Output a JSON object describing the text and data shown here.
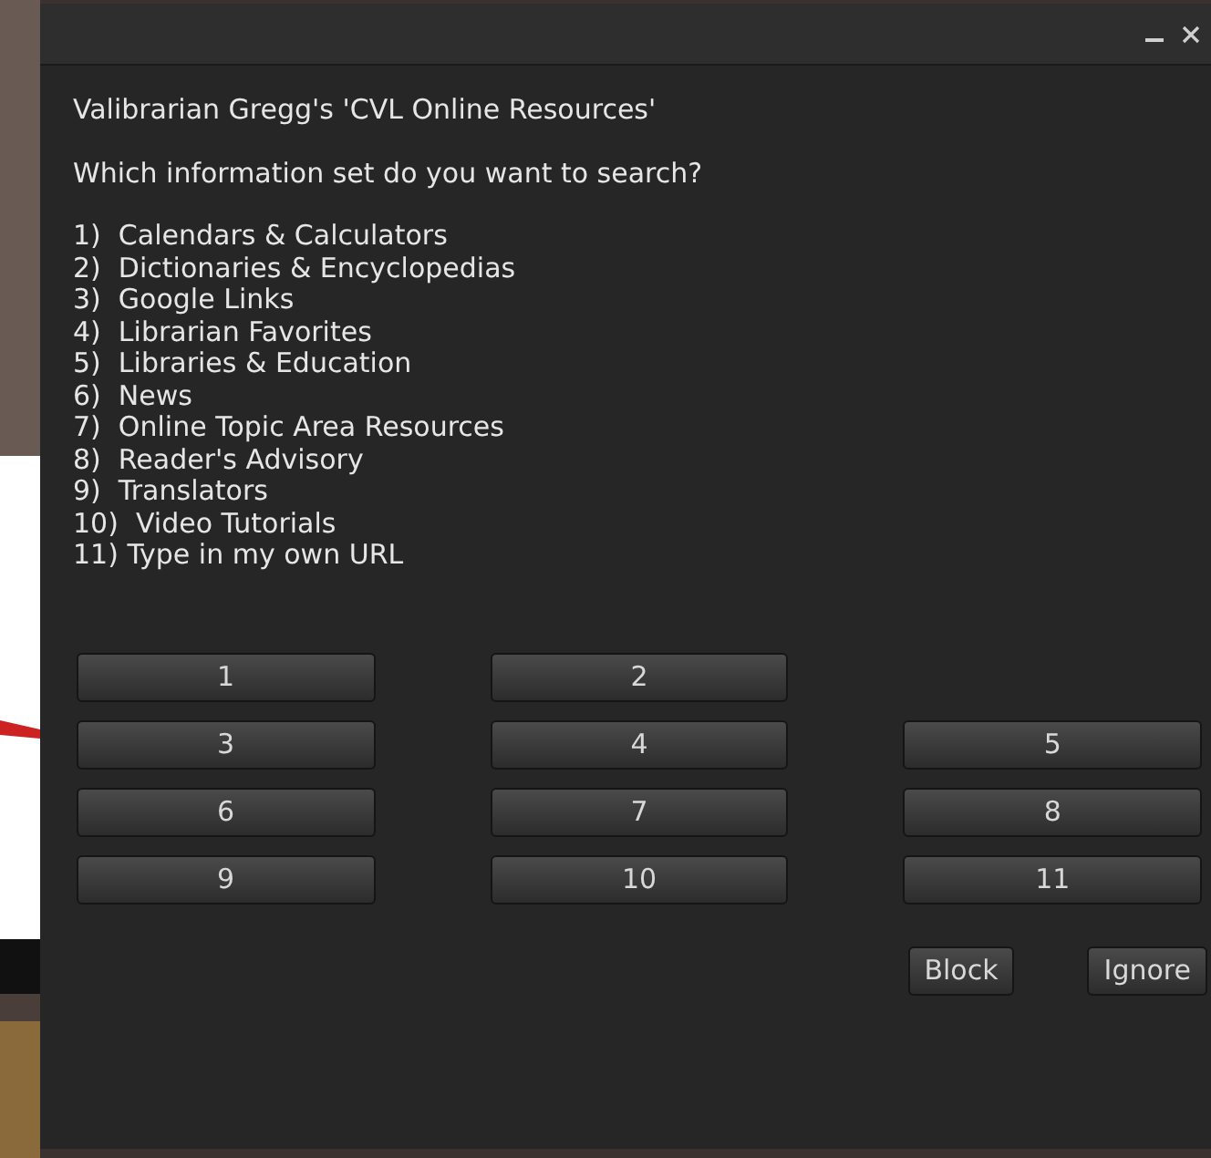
{
  "dialog": {
    "heading": "Valibrarian Gregg's 'CVL Online Resources'",
    "question": "Which information set do you want to search?",
    "options": [
      "1)  Calendars & Calculators",
      "2)  Dictionaries & Encyclopedias",
      "3)  Google Links",
      "4)  Librarian Favorites",
      "5)  Libraries & Education",
      "6)  News",
      "7)  Online Topic Area Resources",
      "8)  Reader's Advisory",
      "9)  Translators",
      "10)  Video Tutorials",
      "11) Type in my own URL"
    ],
    "choice_buttons": [
      "1",
      "2",
      "3",
      "4",
      "5",
      "6",
      "7",
      "8",
      "9",
      "10",
      "11"
    ],
    "footer_buttons": [
      "Block",
      "Ignore"
    ]
  }
}
